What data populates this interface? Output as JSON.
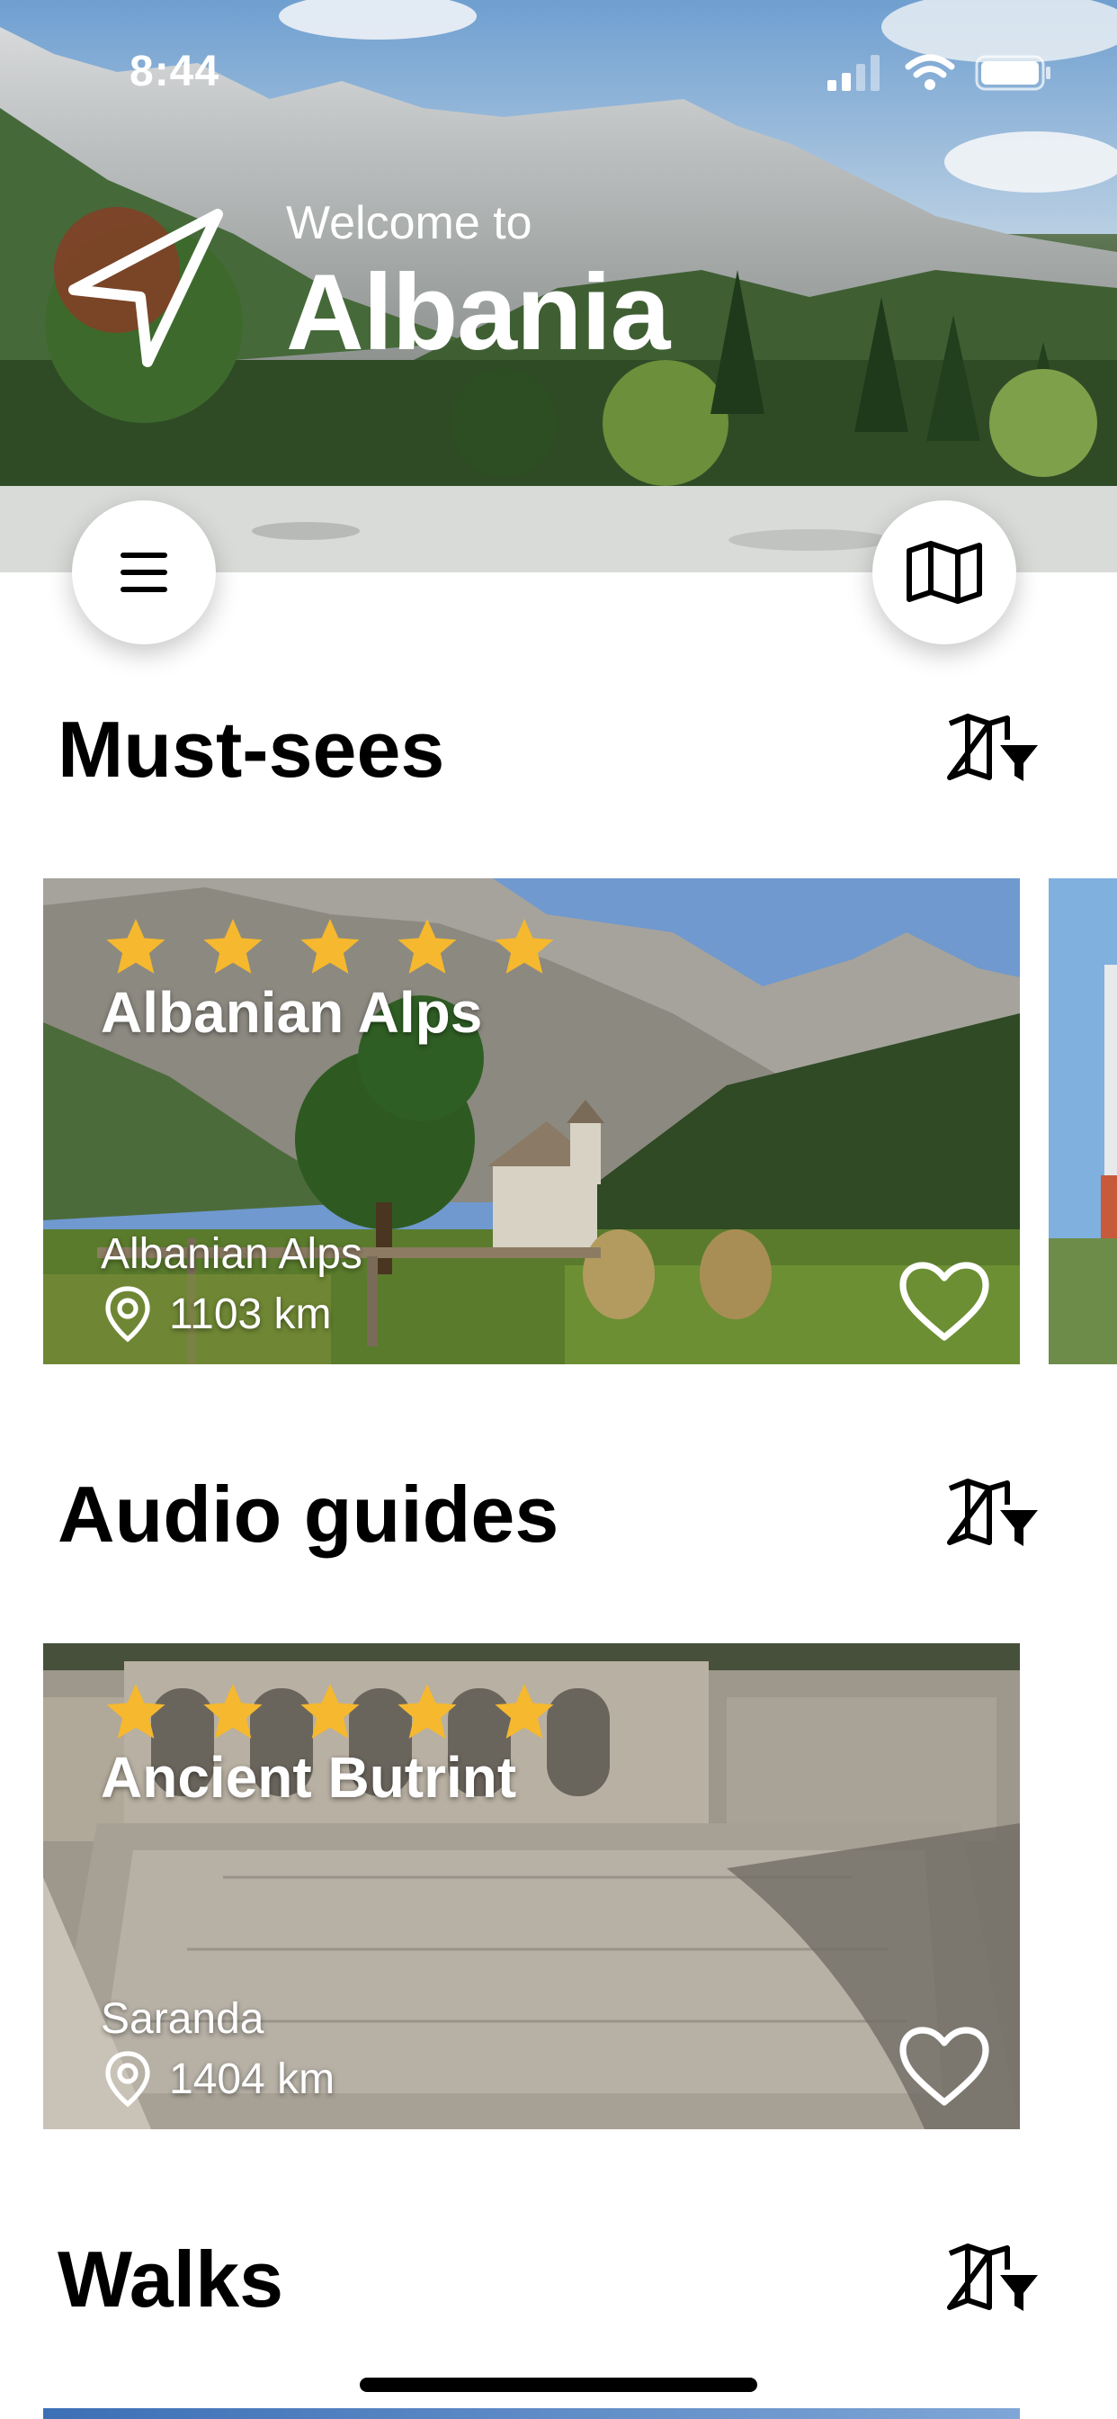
{
  "status_bar": {
    "time": "8:44"
  },
  "header": {
    "welcome": "Welcome to",
    "country": "Albania"
  },
  "sections": [
    {
      "title": "Must-sees",
      "card": {
        "rating": 5,
        "title": "Albanian Alps",
        "region": "Albanian Alps",
        "distance": "1103 km",
        "favorite": false
      }
    },
    {
      "title": "Audio guides",
      "card": {
        "rating": 5,
        "title": "Ancient Butrint",
        "region": "Saranda",
        "distance": "1404 km",
        "favorite": false
      }
    },
    {
      "title": "Walks"
    }
  ],
  "colors": {
    "star": "#f5b82e",
    "text": "#000000",
    "background": "#ffffff"
  },
  "icons": {
    "locator": "navigation-arrow-icon",
    "menu": "hamburger-menu-icon",
    "map": "map-icon",
    "filter": "map-filter-icon",
    "heart": "heart-outline-icon",
    "pin": "location-pin-icon",
    "star": "star-icon"
  }
}
